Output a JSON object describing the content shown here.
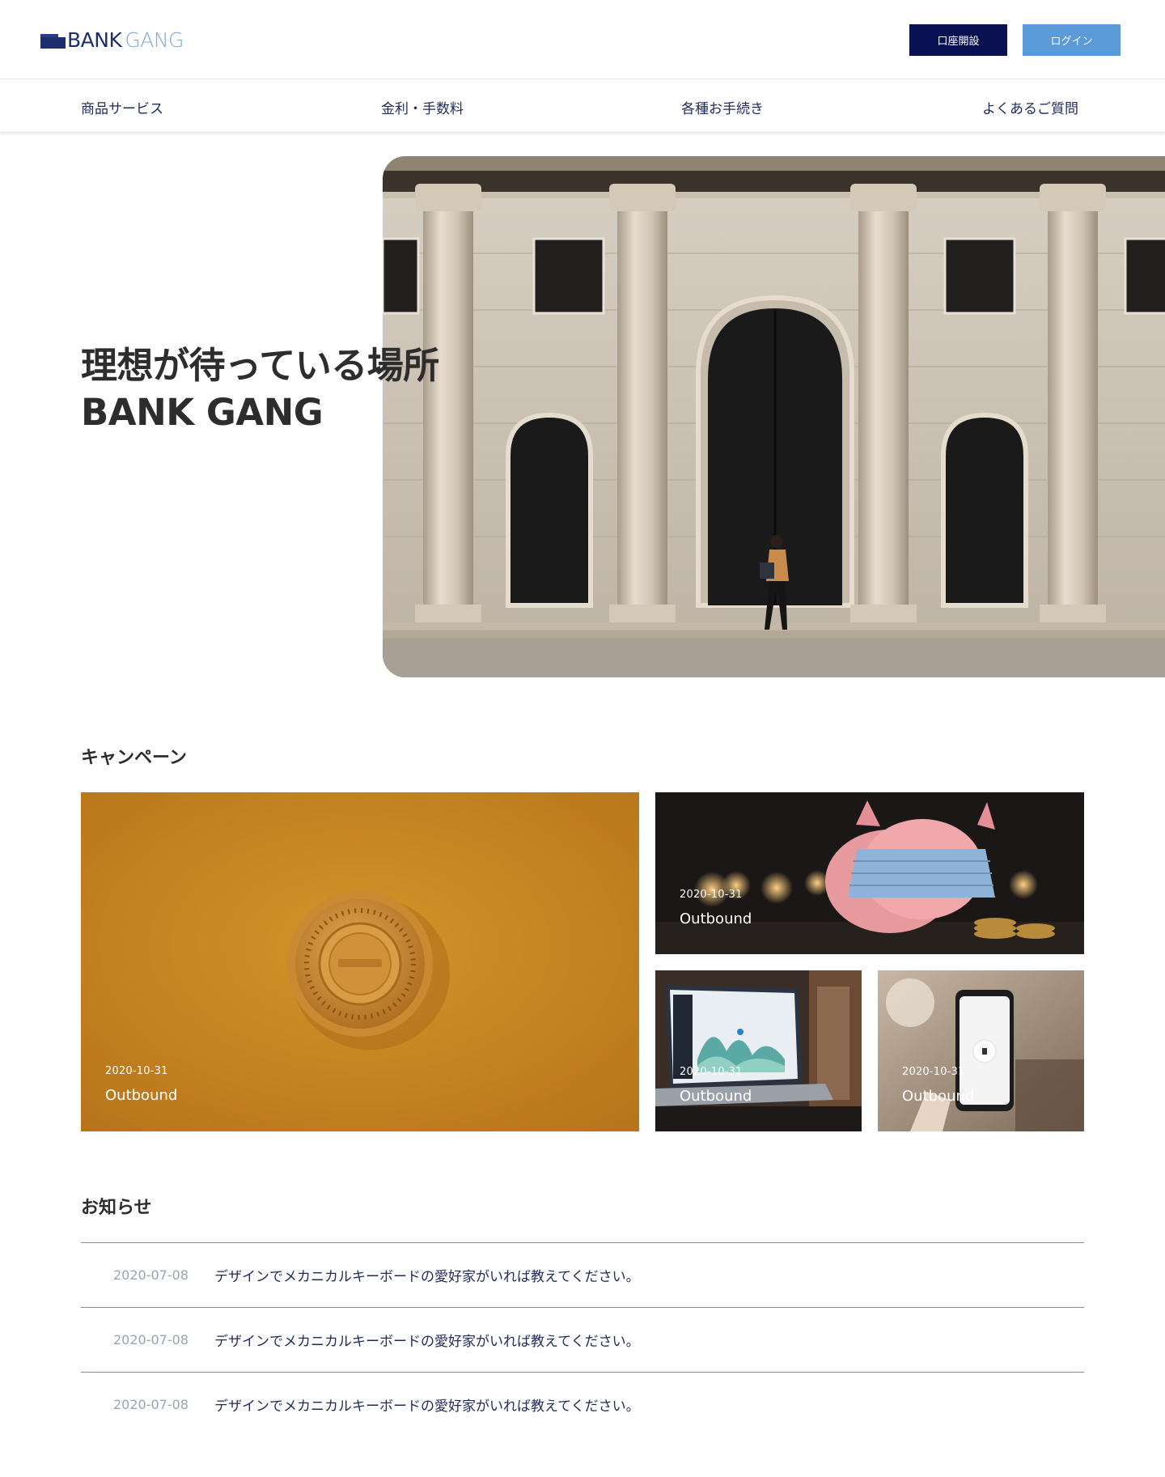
{
  "header": {
    "logo_bold": "BANK",
    "logo_light": "GANG",
    "open_account_label": "口座開設",
    "login_label": "ログイン"
  },
  "nav": {
    "items": [
      {
        "label": "商品サービス"
      },
      {
        "label": "金利・手数料"
      },
      {
        "label": "各種お手続き"
      },
      {
        "label": "よくあるご質問"
      }
    ]
  },
  "hero": {
    "title_line1": "理想が待っている場所",
    "title_line2": "BANK GANG"
  },
  "campaign": {
    "section_title": "キャンペーン",
    "cards": [
      {
        "date": "2020-10-31",
        "title": "Outbound"
      },
      {
        "date": "2020-10-31",
        "title": "Outbound"
      },
      {
        "date": "2020-10-31",
        "title": "Outbound"
      },
      {
        "date": "2020-10-31",
        "title": "Outbound"
      }
    ]
  },
  "news": {
    "section_title": "お知らせ",
    "items": [
      {
        "date": "2020-07-08",
        "text": "デザインでメカニカルキーボードの愛好家がいれば教えてください。"
      },
      {
        "date": "2020-07-08",
        "text": "デザインでメカニカルキーボードの愛好家がいれば教えてください。"
      },
      {
        "date": "2020-07-08",
        "text": "デザインでメカニカルキーボードの愛好家がいれば教えてください。"
      }
    ]
  },
  "colors": {
    "brand_navy": "#0b1254",
    "brand_blue": "#5b9ad9",
    "logo_light": "#7fa7d8"
  }
}
